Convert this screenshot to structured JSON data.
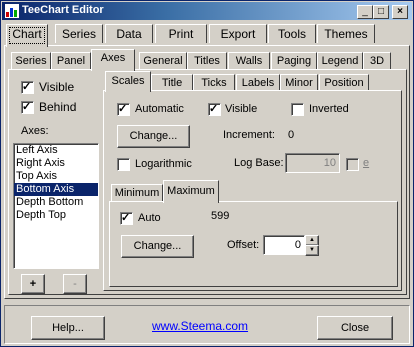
{
  "window": {
    "title": "TeeChart Editor"
  },
  "titlebar_buttons": [
    "_",
    "□",
    "×"
  ],
  "main_tabs": [
    "Chart",
    "Series",
    "Data",
    "Print",
    "Export",
    "Tools",
    "Themes"
  ],
  "chart_tabs": [
    "Series",
    "Panel",
    "Axes",
    "General",
    "Titles",
    "Walls",
    "Paging",
    "Legend",
    "3D"
  ],
  "left": {
    "visible_label": "Visible",
    "behind_label": "Behind",
    "axes_label": "Axes:",
    "axes_items": [
      "Left Axis",
      "Right Axis",
      "Top Axis",
      "Bottom Axis",
      "Depth Bottom",
      "Depth Top"
    ],
    "selected_axis": "Bottom Axis",
    "add_label": "+",
    "remove_label": "-"
  },
  "axis_tabs": [
    "Scales",
    "Title",
    "Ticks",
    "Labels",
    "Minor",
    "Position"
  ],
  "scales": {
    "automatic_label": "Automatic",
    "visible_label": "Visible",
    "inverted_label": "Inverted",
    "change_label": "Change...",
    "increment_label": "Increment:",
    "increment_value": "0",
    "logarithmic_label": "Logarithmic",
    "logbase_label": "Log Base:",
    "logbase_value": "10",
    "e_label": "e"
  },
  "minmax_tabs": [
    "Minimum",
    "Maximum"
  ],
  "maximum": {
    "auto_label": "Auto",
    "value": "599",
    "change_label": "Change...",
    "offset_label": "Offset:",
    "offset_value": "0"
  },
  "footer": {
    "help_label": "Help...",
    "link_text": "www.Steema.com",
    "close_label": "Close"
  }
}
